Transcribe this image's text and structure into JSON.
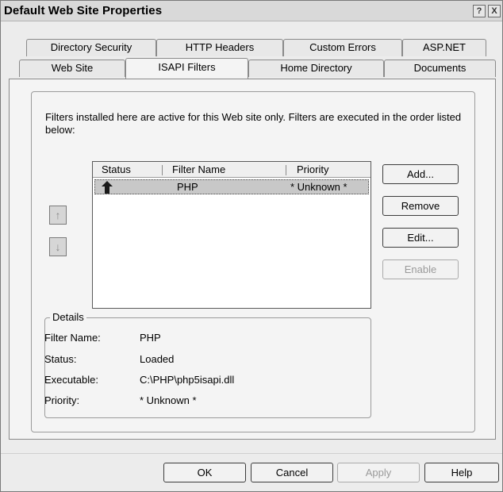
{
  "window": {
    "title": "Default Web Site Properties"
  },
  "titlebar_buttons": {
    "help": "?",
    "close": "X"
  },
  "tabs_row1": [
    "Directory Security",
    "HTTP Headers",
    "Custom Errors",
    "ASP.NET"
  ],
  "tabs_row2": [
    "Web Site",
    "ISAPI Filters",
    "Home Directory",
    "Documents"
  ],
  "active_tab": "ISAPI Filters",
  "description": "Filters installed here are active for this Web site only. Filters are executed in the order listed below:",
  "filter_list": {
    "columns": [
      "Status",
      "Filter Name",
      "Priority"
    ],
    "rows": [
      {
        "status_icon": "up-arrow-icon",
        "name": "PHP",
        "priority": "* Unknown *"
      }
    ]
  },
  "order_buttons": {
    "up": "↑",
    "down": "↓"
  },
  "side_buttons": {
    "add": "Add...",
    "remove": "Remove",
    "edit": "Edit...",
    "enable": "Enable"
  },
  "details": {
    "legend": "Details",
    "filter_name_label": "Filter Name:",
    "filter_name_value": "PHP",
    "status_label": "Status:",
    "status_value": "Loaded",
    "executable_label": "Executable:",
    "executable_value": "C:\\PHP\\php5isapi.dll",
    "priority_label": "Priority:",
    "priority_value": "* Unknown *"
  },
  "dialog_buttons": {
    "ok": "OK",
    "cancel": "Cancel",
    "apply": "Apply",
    "help": "Help"
  }
}
